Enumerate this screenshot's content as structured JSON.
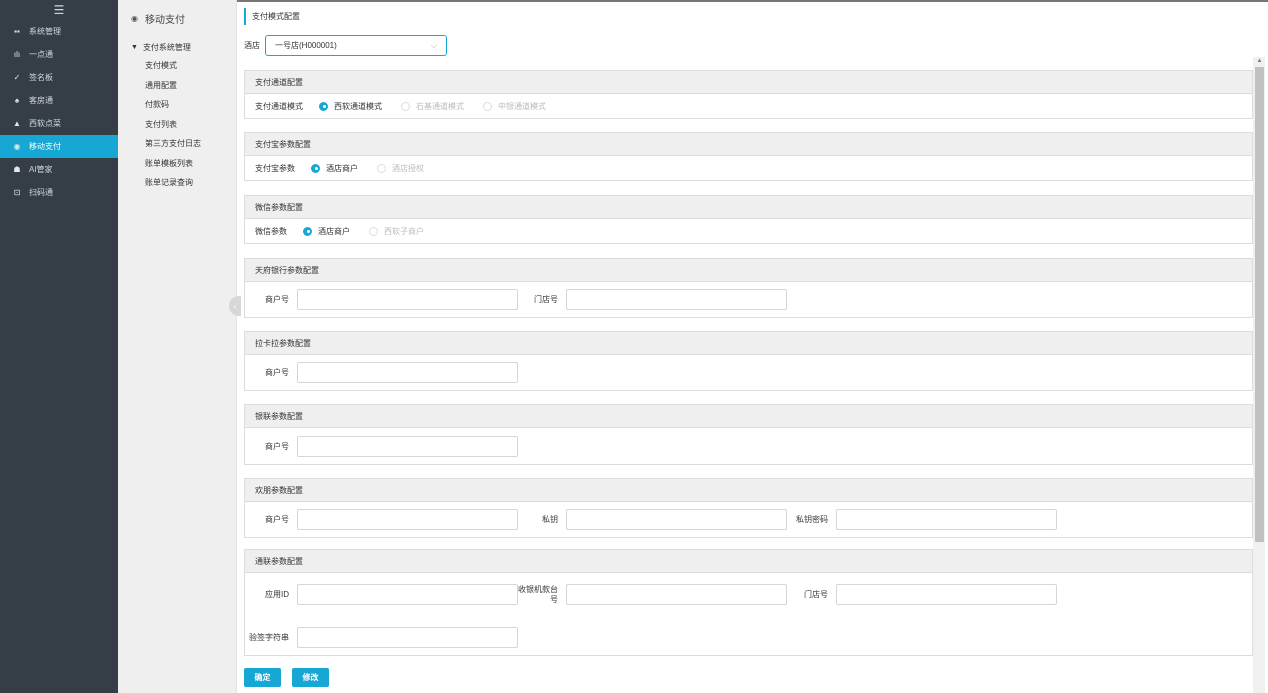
{
  "nav": {
    "items": [
      {
        "icon": "grid-icon",
        "glyph": "▪▪",
        "label": "系统管理"
      },
      {
        "icon": "bar-chart-icon",
        "glyph": "ılı",
        "label": "一点通"
      },
      {
        "icon": "signature-icon",
        "glyph": "✓",
        "label": "签名板"
      },
      {
        "icon": "home-icon",
        "glyph": "♠",
        "label": "客房通"
      },
      {
        "icon": "food-icon",
        "glyph": "▲",
        "label": "西软点菜"
      },
      {
        "icon": "mobile-pay-icon",
        "glyph": "◉",
        "label": "移动支付"
      },
      {
        "icon": "ai-icon",
        "glyph": "☗",
        "label": "AI管家"
      },
      {
        "icon": "scan-icon",
        "glyph": "⊡",
        "label": "扫码通"
      }
    ],
    "active_index": 5
  },
  "sub": {
    "header": "移动支付",
    "group": "支付系统管理",
    "items": [
      "支付模式",
      "通用配置",
      "付款码",
      "支付列表",
      "第三方支付日志",
      "账单模板列表",
      "账单记录查询"
    ]
  },
  "page": {
    "title": "支付模式配置",
    "hotel_label": "酒店",
    "hotel_value": "一号店(H000001)"
  },
  "sections": {
    "channel": {
      "title": "支付通道配置",
      "label": "支付通道模式",
      "options": [
        "西软通道模式",
        "石基通道模式",
        "中银通道模式"
      ],
      "selected": 0
    },
    "alipay": {
      "title": "支付宝参数配置",
      "label": "支付宝参数",
      "options": [
        "酒店商户",
        "酒店授权"
      ],
      "selected": 0
    },
    "wechat": {
      "title": "微信参数配置",
      "label": "微信参数",
      "options": [
        "酒店商户",
        "西软子商户"
      ],
      "selected": 0
    },
    "tianfu": {
      "title": "天府银行参数配置",
      "merchant_label": "商户号",
      "store_label": "门店号"
    },
    "lakala": {
      "title": "拉卡拉参数配置",
      "merchant_label": "商户号"
    },
    "unionpay": {
      "title": "银联参数配置",
      "merchant_label": "商户号"
    },
    "huanpeng": {
      "title": "欢朋参数配置",
      "merchant_label": "商户号",
      "key_label": "私钥",
      "key_pwd_label": "私钥密码"
    },
    "tonglian": {
      "title": "通联参数配置",
      "app_id_label": "应用ID",
      "cashier_label": "收银机款台号",
      "store_label": "门店号",
      "sign_label": "验签字符串"
    }
  },
  "buttons": {
    "confirm": "确定",
    "modify": "修改"
  },
  "colors": {
    "accent": "#17a7d4",
    "nav_bg": "#353e47"
  }
}
